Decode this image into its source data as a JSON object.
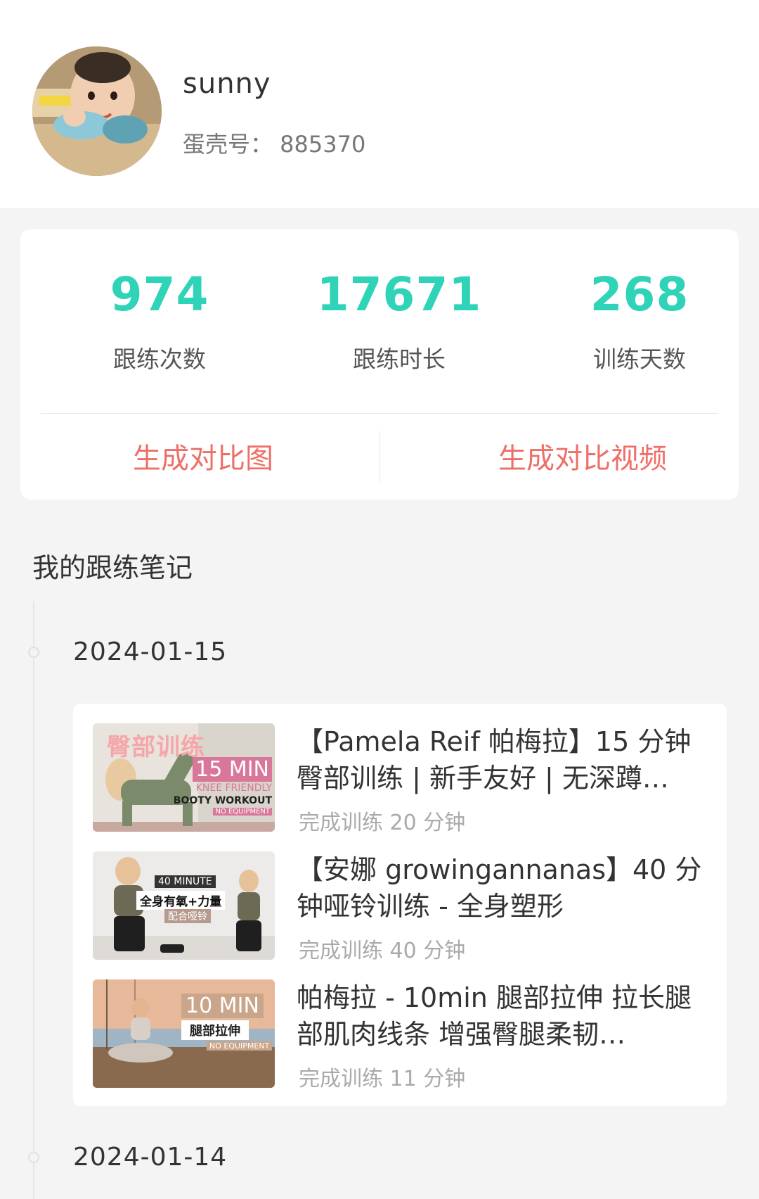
{
  "profile": {
    "username": "sunny",
    "id_label": "蛋壳号：",
    "id_value": "885370",
    "id_text": "蛋壳号： 885370"
  },
  "stats": [
    {
      "value": "974",
      "label": "跟练次数"
    },
    {
      "value": "17671",
      "label": "跟练时长"
    },
    {
      "value": "268",
      "label": "训练天数"
    }
  ],
  "actions": {
    "compare_image": "生成对比图",
    "compare_video": "生成对比视频"
  },
  "section": {
    "title": "我的跟练笔记"
  },
  "timeline": [
    {
      "date": "2024-01-15",
      "notes": [
        {
          "title": "【Pamela Reif 帕梅拉】15 分钟 臀部训练 | 新手友好 | 无深蹲…",
          "meta": "完成训练 20 分钟",
          "thumb_text": [
            "臀部训练",
            "15 MIN",
            "KNEE FRIENDLY",
            "BOOTY WORKOUT",
            "NO EQUIPMENT"
          ]
        },
        {
          "title": "【安娜 growingannanas】40 分钟哑铃训练 - 全身塑形",
          "meta": "完成训练 40 分钟",
          "thumb_text": [
            "40 MINUTE",
            "全身有氧+力量",
            "配合哑铃"
          ]
        },
        {
          "title": "帕梅拉 - 10min 腿部拉伸 拉长腿部肌肉线条 增强臀腿柔韧…",
          "meta": "完成训练 11 分钟",
          "thumb_text": [
            "10 MIN",
            "腿部拉伸",
            "NO EQUIPMENT"
          ]
        }
      ]
    },
    {
      "date": "2024-01-14",
      "notes": []
    }
  ],
  "colors": {
    "accent_teal": "#2fd3b8",
    "action_red": "#ee6f67",
    "background": "#f4f4f5"
  }
}
